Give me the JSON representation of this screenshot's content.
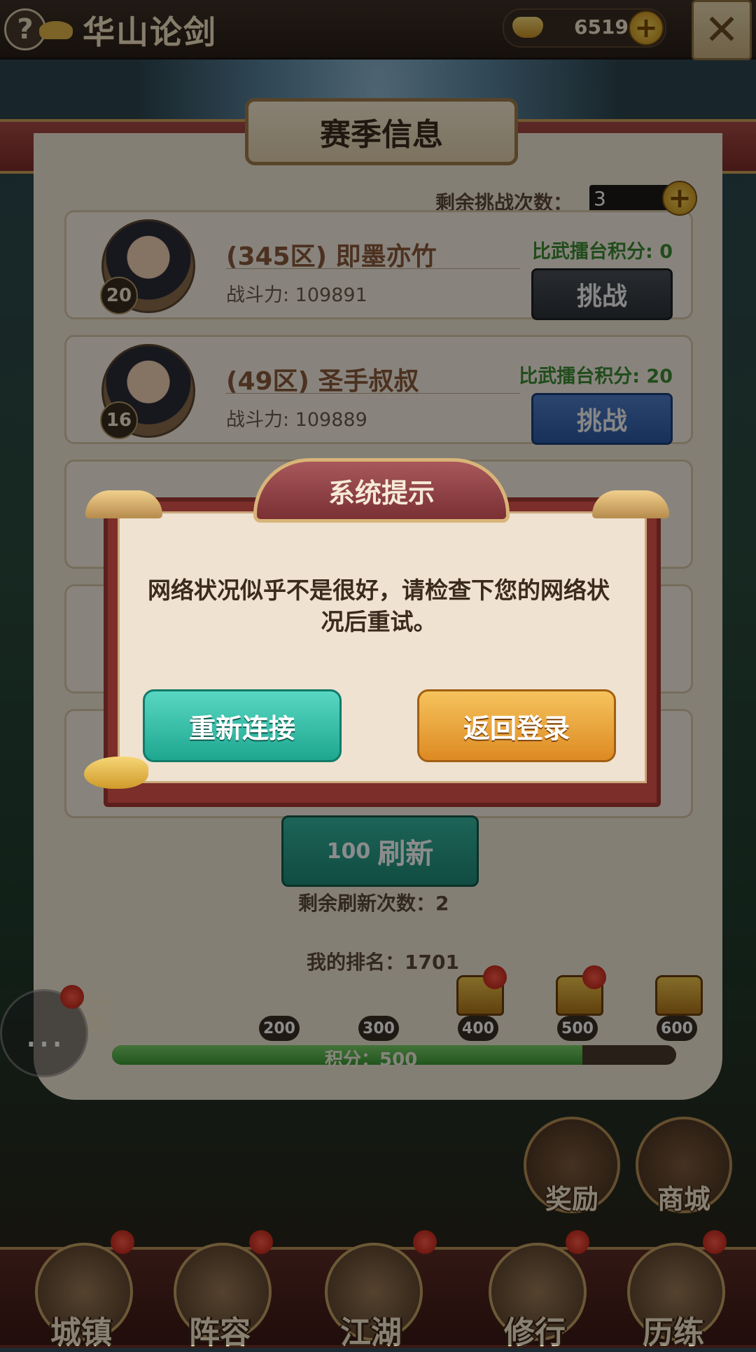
{
  "header": {
    "title": "华山论剑",
    "help_icon": "?",
    "gold": "6519",
    "close_icon": "✕"
  },
  "season": {
    "title": "赛季信息",
    "remaining_label": "剩余挑战次数：",
    "remaining_value": "3"
  },
  "opponents": [
    {
      "name": "(345区) 即墨亦竹",
      "level": "20",
      "power": "战斗力: 109891",
      "score": "比武擂台积分: 0",
      "button": "挑战"
    },
    {
      "name": "(49区) 圣手叔叔",
      "level": "16",
      "power": "战斗力: 109889",
      "score": "比武擂台积分: 20",
      "button": "挑战"
    }
  ],
  "refresh": {
    "cost": "100",
    "label": "刷新",
    "remaining": "剩余刷新次数：2"
  },
  "rank": "我的排名：1701",
  "progress": {
    "label": "积分：500",
    "value": 500,
    "max": 600,
    "milestones": [
      "200",
      "300",
      "400",
      "500",
      "600"
    ]
  },
  "score_reward": "积分\n奖励",
  "side": {
    "reward": "奖励",
    "shop": "商城"
  },
  "nav": [
    "城镇",
    "阵容",
    "江湖",
    "修行",
    "历练"
  ],
  "dialog": {
    "title": "系统提示",
    "message": "网络状况似乎不是很好，请检查下您的网络状况后重试。",
    "reconnect": "重新连接",
    "back_login": "返回登录"
  }
}
